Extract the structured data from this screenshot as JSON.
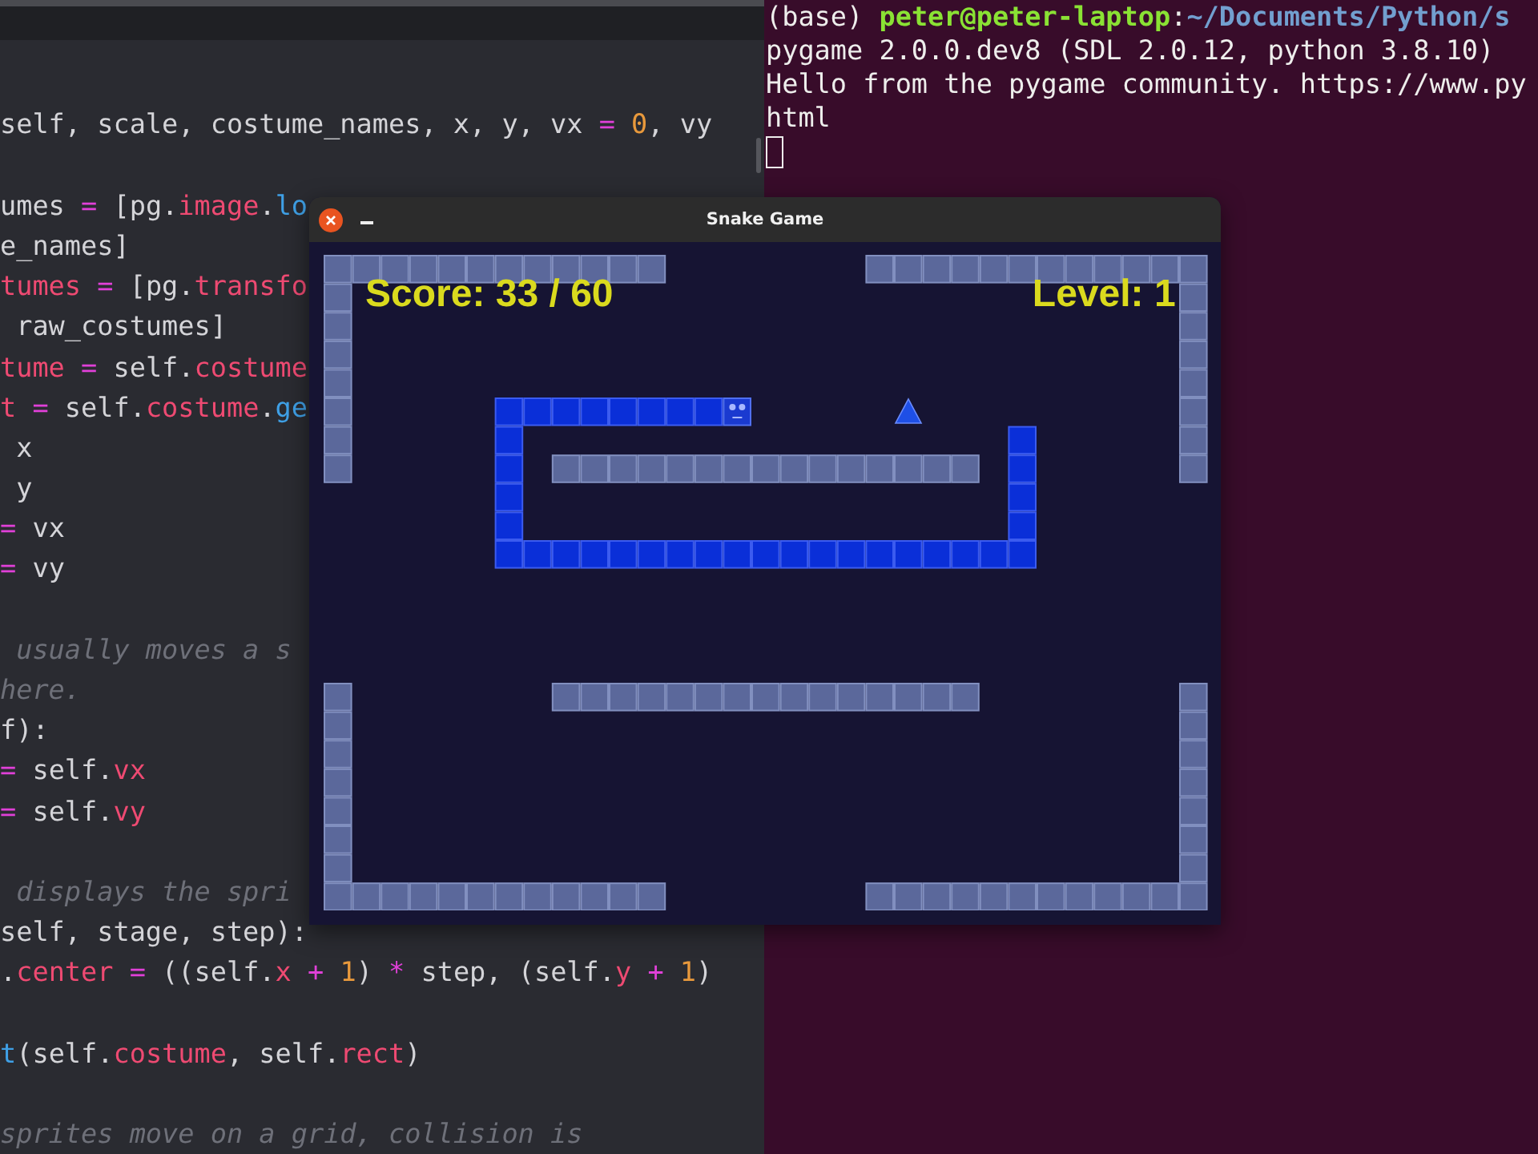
{
  "editor": {
    "lines": [
      {
        "kind": "code",
        "tokens": [
          {
            "text": "self, scale, costume_names, x, y, vx",
            "kind": "plain"
          },
          {
            "text": " = ",
            "kind": "operator"
          },
          {
            "text": "0",
            "kind": "number"
          },
          {
            "text": ", vy",
            "kind": "plain"
          }
        ]
      },
      {
        "kind": "blank"
      },
      {
        "kind": "code",
        "tokens": [
          {
            "text": "umes ",
            "kind": "plain"
          },
          {
            "text": "=",
            "kind": "operator"
          },
          {
            "text": " [pg.",
            "kind": "plain"
          },
          {
            "text": "image",
            "kind": "attribute"
          },
          {
            "text": ".",
            "kind": "plain"
          },
          {
            "text": "lo",
            "kind": "call"
          }
        ]
      },
      {
        "kind": "code",
        "tokens": [
          {
            "text": "e_names]",
            "kind": "plain"
          }
        ]
      },
      {
        "kind": "code",
        "tokens": [
          {
            "text": "tumes",
            "kind": "attribute"
          },
          {
            "text": " =",
            "kind": "operator"
          },
          {
            "text": " [pg.",
            "kind": "plain"
          },
          {
            "text": "transfo",
            "kind": "attribute"
          }
        ]
      },
      {
        "kind": "code",
        "tokens": [
          {
            "text": " raw_costumes]",
            "kind": "plain"
          }
        ]
      },
      {
        "kind": "code",
        "tokens": [
          {
            "text": "tume",
            "kind": "attribute"
          },
          {
            "text": " =",
            "kind": "operator"
          },
          {
            "text": " self.",
            "kind": "plain"
          },
          {
            "text": "costume",
            "kind": "attribute"
          }
        ]
      },
      {
        "kind": "code",
        "tokens": [
          {
            "text": "t",
            "kind": "attribute"
          },
          {
            "text": " =",
            "kind": "operator"
          },
          {
            "text": " self.",
            "kind": "plain"
          },
          {
            "text": "costume",
            "kind": "attribute"
          },
          {
            "text": ".",
            "kind": "plain"
          },
          {
            "text": "ge",
            "kind": "call"
          }
        ]
      },
      {
        "kind": "code",
        "tokens": [
          {
            "text": " x",
            "kind": "plain"
          }
        ]
      },
      {
        "kind": "code",
        "tokens": [
          {
            "text": " y",
            "kind": "plain"
          }
        ]
      },
      {
        "kind": "code",
        "tokens": [
          {
            "text": "=",
            "kind": "operator"
          },
          {
            "text": " vx",
            "kind": "plain"
          }
        ]
      },
      {
        "kind": "code",
        "tokens": [
          {
            "text": "=",
            "kind": "operator"
          },
          {
            "text": " vy",
            "kind": "plain"
          }
        ]
      },
      {
        "kind": "blank"
      },
      {
        "kind": "code",
        "tokens": [
          {
            "text": " usually moves a s",
            "kind": "comment"
          }
        ]
      },
      {
        "kind": "code",
        "tokens": [
          {
            "text": "here.",
            "kind": "comment"
          }
        ]
      },
      {
        "kind": "code",
        "tokens": [
          {
            "text": "f):",
            "kind": "plain"
          }
        ]
      },
      {
        "kind": "code",
        "tokens": [
          {
            "text": "=",
            "kind": "operator"
          },
          {
            "text": " self.",
            "kind": "plain"
          },
          {
            "text": "vx",
            "kind": "attribute"
          }
        ]
      },
      {
        "kind": "code",
        "tokens": [
          {
            "text": "=",
            "kind": "operator"
          },
          {
            "text": " self.",
            "kind": "plain"
          },
          {
            "text": "vy",
            "kind": "attribute"
          }
        ]
      },
      {
        "kind": "blank"
      },
      {
        "kind": "code",
        "tokens": [
          {
            "text": " displays the spri",
            "kind": "comment"
          }
        ]
      },
      {
        "kind": "code",
        "tokens": [
          {
            "text": "self, stage, step):",
            "kind": "plain"
          }
        ]
      },
      {
        "kind": "code",
        "tokens": [
          {
            "text": ".",
            "kind": "plain"
          },
          {
            "text": "center",
            "kind": "attribute"
          },
          {
            "text": " =",
            "kind": "operator"
          },
          {
            "text": " ((self.",
            "kind": "plain"
          },
          {
            "text": "x",
            "kind": "attribute"
          },
          {
            "text": " + ",
            "kind": "operator"
          },
          {
            "text": "1",
            "kind": "number"
          },
          {
            "text": ") ",
            "kind": "plain"
          },
          {
            "text": "*",
            "kind": "operator"
          },
          {
            "text": " step, (self.",
            "kind": "plain"
          },
          {
            "text": "y",
            "kind": "attribute"
          },
          {
            "text": " + ",
            "kind": "operator"
          },
          {
            "text": "1",
            "kind": "number"
          },
          {
            "text": ")",
            "kind": "plain"
          }
        ]
      },
      {
        "kind": "blank"
      },
      {
        "kind": "code",
        "tokens": [
          {
            "text": "t",
            "kind": "call"
          },
          {
            "text": "(self.",
            "kind": "plain"
          },
          {
            "text": "costume",
            "kind": "attribute"
          },
          {
            "text": ", self.",
            "kind": "plain"
          },
          {
            "text": "rect",
            "kind": "attribute"
          },
          {
            "text": ")",
            "kind": "plain"
          }
        ]
      },
      {
        "kind": "blank"
      },
      {
        "kind": "code",
        "tokens": [
          {
            "text": "sprites move on a grid, collision is",
            "kind": "comment"
          }
        ]
      }
    ]
  },
  "terminal": {
    "lines": [
      {
        "segments": [
          {
            "text": "(base) ",
            "kind": "plain"
          },
          {
            "text": "peter@peter-laptop",
            "kind": "user"
          },
          {
            "text": ":",
            "kind": "plain"
          },
          {
            "text": "~/Documents/Python/s",
            "kind": "path"
          }
        ]
      },
      {
        "segments": [
          {
            "text": "pygame 2.0.0.dev8 (SDL 2.0.12, python 3.8.10)",
            "kind": "plain"
          }
        ]
      },
      {
        "segments": [
          {
            "text": "Hello from the pygame community. https://www.py",
            "kind": "plain"
          }
        ]
      },
      {
        "segments": [
          {
            "text": "html",
            "kind": "plain"
          }
        ]
      }
    ]
  },
  "game_window": {
    "title": "Snake Game",
    "score": "Score: 33 / 60",
    "level": "Level: 1"
  }
}
